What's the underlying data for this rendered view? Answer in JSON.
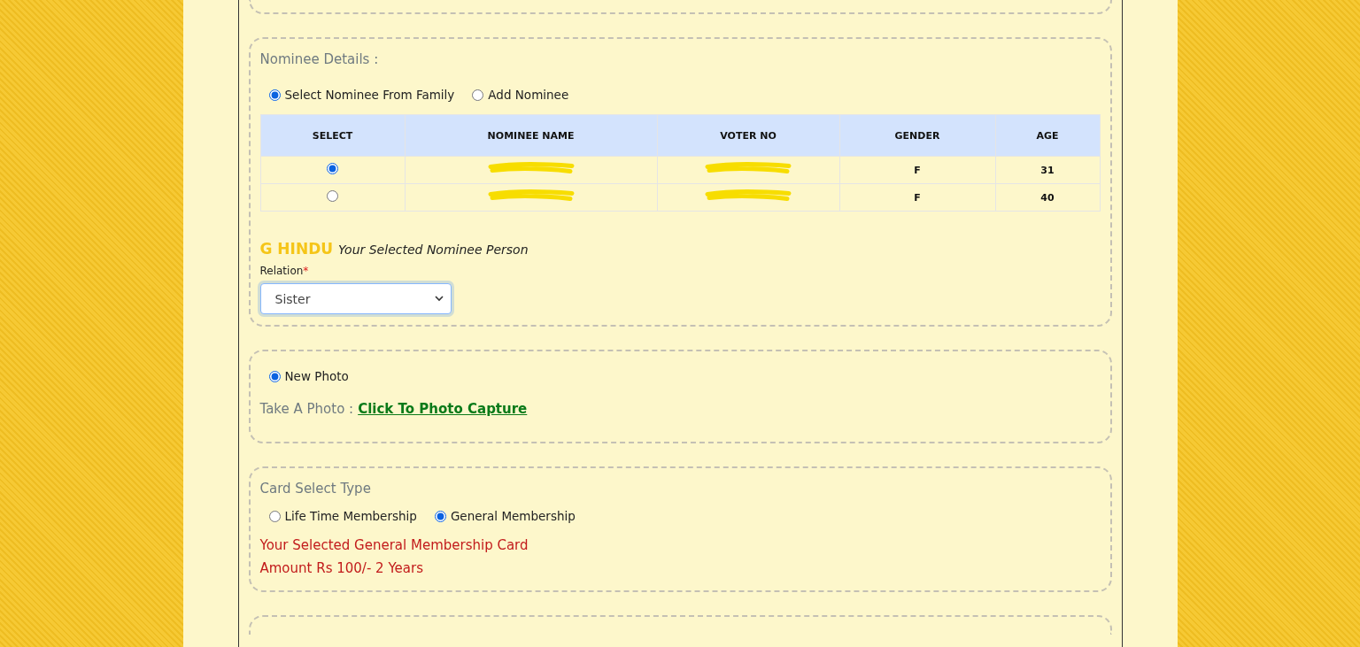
{
  "nominee_section": {
    "title": "Nominee Details :",
    "mode_options": [
      {
        "label": "Select Nominee From Family",
        "selected": true
      },
      {
        "label": "Add Nominee",
        "selected": false
      }
    ],
    "table": {
      "columns": [
        "SELECT",
        "NOMINEE NAME",
        "VOTER NO",
        "GENDER",
        "AGE"
      ],
      "rows": [
        {
          "selected": true,
          "name_redacted": true,
          "voter_no_redacted": true,
          "gender": "F",
          "age": "31"
        },
        {
          "selected": false,
          "name_redacted": true,
          "voter_no_redacted": true,
          "gender": "F",
          "age": "40"
        }
      ]
    },
    "selected_nominee": {
      "name": "G HINDU",
      "caption": "Your Selected Nominee Person"
    },
    "relation": {
      "label": "Relation",
      "required_mark": "*",
      "value": "Sister"
    }
  },
  "photo_section": {
    "options": [
      {
        "label": "New Photo",
        "selected": true
      }
    ],
    "prompt": "Take A Photo :",
    "link": "Click To Photo Capture"
  },
  "card_section": {
    "title": "Card Select Type",
    "options": [
      {
        "label": "Life Time Membership",
        "selected": false
      },
      {
        "label": "General Membership",
        "selected": true
      }
    ],
    "message": "Your Selected General Membership Card",
    "amount": "Amount Rs 100/- 2 Years"
  }
}
